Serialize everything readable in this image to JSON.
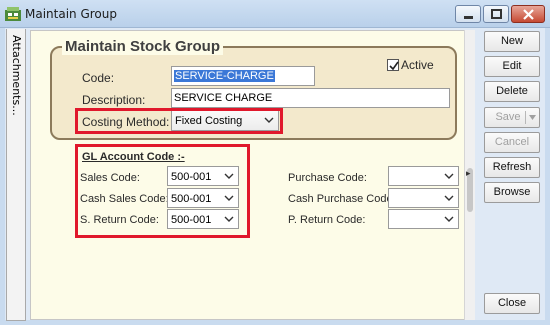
{
  "window": {
    "title": "Maintain Group"
  },
  "side_tab": {
    "label": "Attachments..."
  },
  "form": {
    "group_title": "Maintain Stock Group",
    "active_label": "Active",
    "active_checked": true,
    "code_label": "Code:",
    "code_value": "SERVICE-CHARGE",
    "description_label": "Description:",
    "description_value": "SERVICE CHARGE",
    "costing_label": "Costing Method:",
    "costing_value": "Fixed Costing"
  },
  "gl": {
    "heading": "GL Account Code :-",
    "sales_label": "Sales Code:",
    "sales_value": "500-001",
    "cash_sales_label": "Cash Sales Code:",
    "cash_sales_value": "500-001",
    "sreturn_label": "S. Return Code:",
    "sreturn_value": "500-001",
    "purchase_label": "Purchase Code:",
    "purchase_value": "",
    "cash_purchase_label": "Cash Purchase Code:",
    "cash_purchase_value": "",
    "preturn_label": "P. Return Code:",
    "preturn_value": ""
  },
  "buttons": {
    "new": "New",
    "edit": "Edit",
    "delete": "Delete",
    "save": "Save",
    "cancel": "Cancel",
    "refresh": "Refresh",
    "browse": "Browse",
    "close": "Close"
  },
  "colors": {
    "highlight_box": "#e0182c",
    "panel_bg": "#fdfce8",
    "group_bg": "#f3e9cc"
  }
}
